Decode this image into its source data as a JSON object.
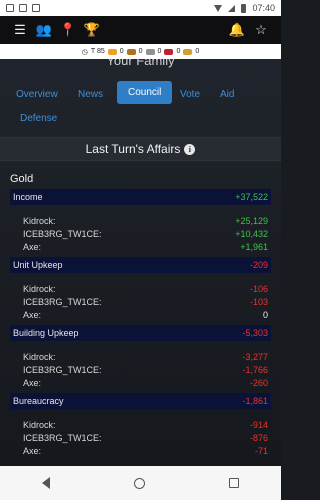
{
  "status": {
    "time": "07:40"
  },
  "resources": {
    "turn_label": "T 85",
    "items": [
      {
        "icon": "food-icon",
        "value": "0",
        "color": "#f0a020"
      },
      {
        "icon": "lumber-icon",
        "value": "0",
        "color": "#b07020"
      },
      {
        "icon": "stone-icon",
        "value": "0",
        "color": "#909090"
      },
      {
        "icon": "ore-icon",
        "value": "0",
        "color": "#c02030"
      },
      {
        "icon": "gold-icon",
        "value": "0",
        "color": "#d0a030"
      }
    ]
  },
  "page": {
    "cut_title": "Your Family"
  },
  "tabs": [
    {
      "label": "Overview",
      "active": false
    },
    {
      "label": "News",
      "active": false
    },
    {
      "label": "Council",
      "active": true
    },
    {
      "label": "Vote",
      "active": false
    },
    {
      "label": "Aid",
      "active": false
    },
    {
      "label": "Defense",
      "active": false
    }
  ],
  "affairs": {
    "title": "Last Turn's Affairs"
  },
  "gold_label": "Gold",
  "sections": [
    {
      "title": "Income",
      "total": "+37,522",
      "rows": [
        {
          "name": "Kidrock:",
          "value": "+25,129"
        },
        {
          "name": "ICEB3RG_TW1CE:",
          "value": "+10,432"
        },
        {
          "name": "Axe:",
          "value": "+1,961"
        }
      ]
    },
    {
      "title": "Unit Upkeep",
      "total": "-209",
      "rows": [
        {
          "name": "Kidrock:",
          "value": "-106"
        },
        {
          "name": "ICEB3RG_TW1CE:",
          "value": "-103"
        },
        {
          "name": "Axe:",
          "value": "0"
        }
      ]
    },
    {
      "title": "Building Upkeep",
      "total": "-5,303",
      "rows": [
        {
          "name": "Kidrock:",
          "value": "-3,277"
        },
        {
          "name": "ICEB3RG_TW1CE:",
          "value": "-1,766"
        },
        {
          "name": "Axe:",
          "value": "-260"
        }
      ]
    },
    {
      "title": "Bureaucracy",
      "total": "-1,861",
      "rows": [
        {
          "name": "Kidrock:",
          "value": "-914"
        },
        {
          "name": "ICEB3RG_TW1CE:",
          "value": "-876"
        },
        {
          "name": "Axe:",
          "value": "-71"
        }
      ]
    }
  ]
}
